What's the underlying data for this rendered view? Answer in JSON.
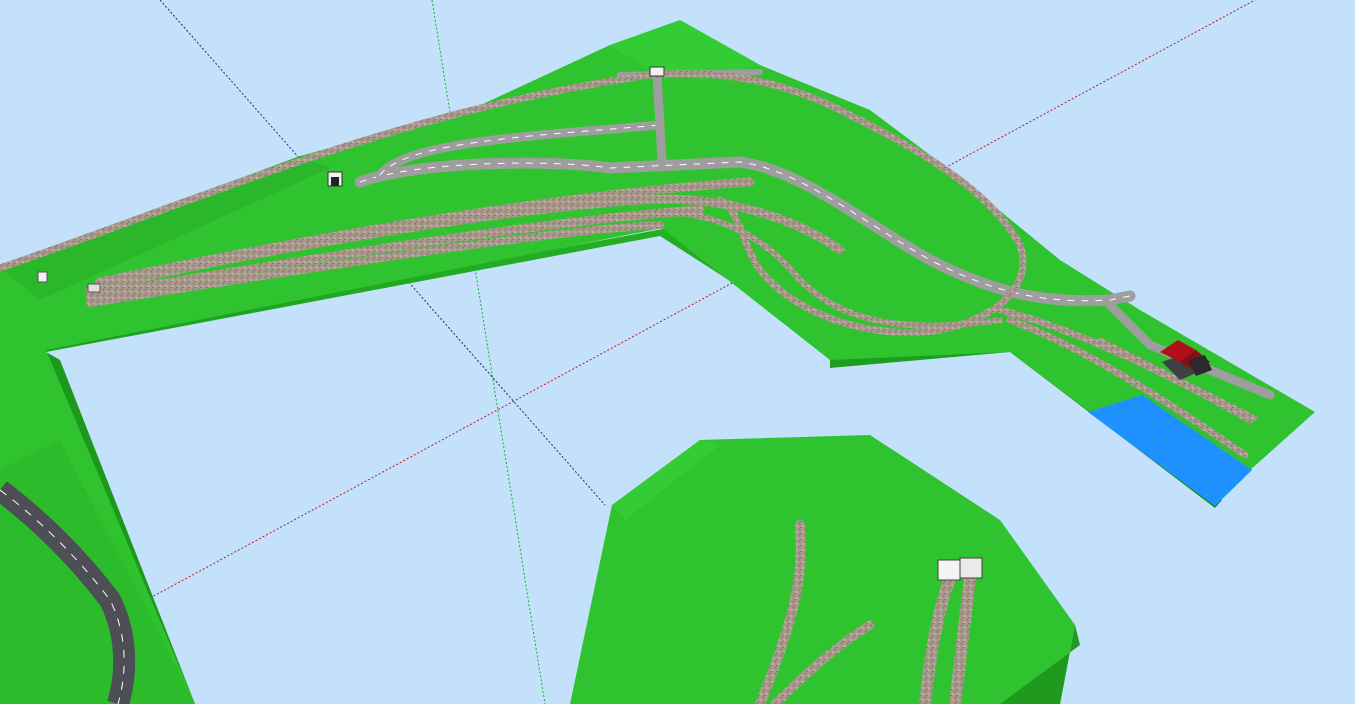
{
  "scene": {
    "kind": "3d-track-layout-view",
    "background_color": "#c3e1fb",
    "terrain_color": "#2fc42f",
    "terrain_shadow_color": "#1f9a1f",
    "water_color": "#1e90ff",
    "ballast_color": "#a8988c",
    "road_color": "#a7a7a7",
    "dark_road_color": "#4d4d55",
    "building_roof_color": "#b0101a",
    "axis_colors": {
      "red": "#d01020",
      "green": "#10b030",
      "blue": "#2030a0"
    },
    "icons": [
      "tunnel-portal-icon",
      "house-icon",
      "water-pond-icon"
    ]
  }
}
